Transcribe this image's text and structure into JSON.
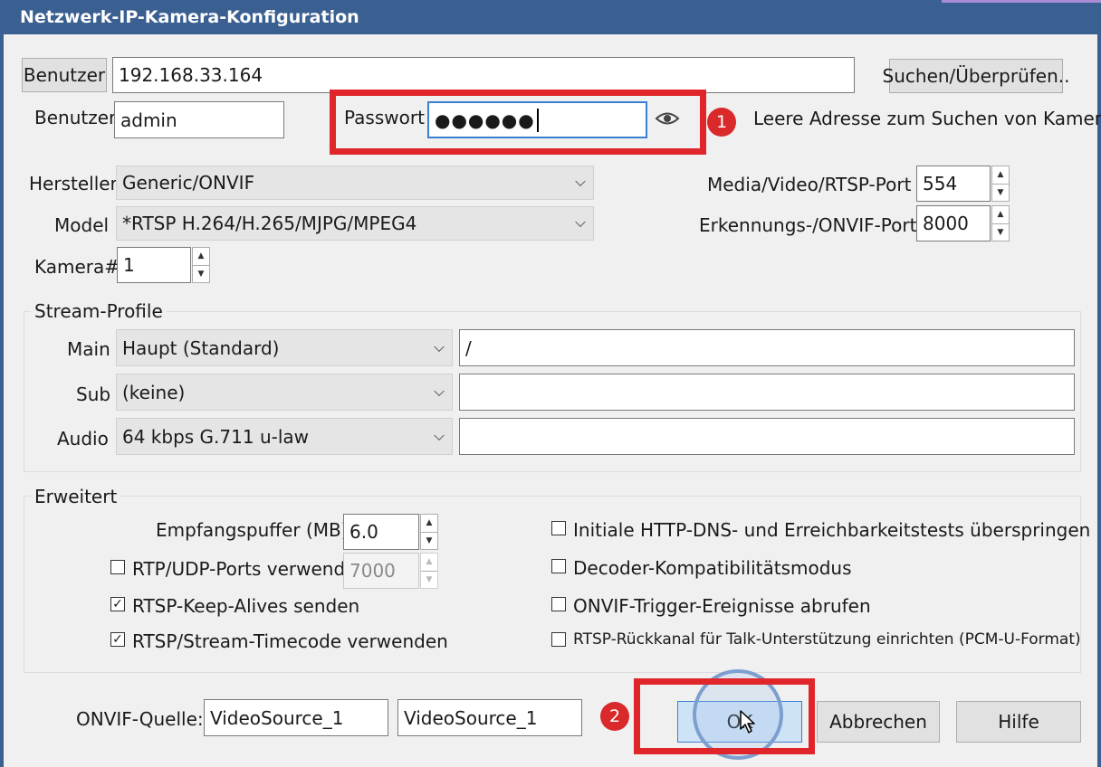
{
  "window": {
    "title": "Netzwerk-IP-Kamera-Konfiguration"
  },
  "address": {
    "button_label": "Benutzer",
    "value": "192.168.33.164",
    "search_button": "Suchen/Überprüfen.."
  },
  "login": {
    "user_label": "Benutzer",
    "user_value": "admin",
    "password_label": "Passwort",
    "password_value": "●●●●●●",
    "hint": "Leere Adresse zum Suchen von Kameras"
  },
  "device": {
    "manufacturer_label": "Hersteller",
    "manufacturer_value": "Generic/ONVIF",
    "model_label": "Model",
    "model_value": "*RTSP H.264/H.265/MJPG/MPEG4",
    "camera_label": "Kamera#",
    "camera_value": "1",
    "media_port_label": "Media/Video/RTSP-Port",
    "media_port_value": "554",
    "onvif_port_label": "Erkennungs-/ONVIF-Port",
    "onvif_port_value": "8000"
  },
  "streams": {
    "title": "Stream-Profile",
    "main_label": "Main",
    "main_value": "Haupt (Standard)",
    "main_path": "/",
    "sub_label": "Sub",
    "sub_value": "(keine)",
    "sub_path": "",
    "audio_label": "Audio",
    "audio_value": "64 kbps G.711 u-law",
    "audio_path": ""
  },
  "advanced": {
    "title": "Erweitert",
    "buffer_label": "Empfangspuffer (MB)",
    "buffer_value": "6.0",
    "rtp_label": "RTP/UDP-Ports verwenden",
    "rtp_checked": false,
    "rtp_value": "7000",
    "keepalive_label": "RTSP-Keep-Alives senden",
    "keepalive_checked": true,
    "timecode_label": "RTSP/Stream-Timecode verwenden",
    "timecode_checked": true,
    "skip_tests_label": "Initiale HTTP-DNS- und Erreichbarkeitstests überspringen",
    "skip_tests_checked": false,
    "decoder_label": "Decoder-Kompatibilitätsmodus",
    "decoder_checked": false,
    "onvif_trigger_label": "ONVIF-Trigger-Ereignisse abrufen",
    "onvif_trigger_checked": false,
    "backchannel_label": "RTSP-Rückkanal für Talk-Unterstützung einrichten (PCM-U-Format)",
    "backchannel_checked": false
  },
  "footer": {
    "onvif_source_label": "ONVIF-Quelle:",
    "onvif_source_1": "VideoSource_1",
    "onvif_source_2": "VideoSource_1",
    "ok_label": "OK",
    "cancel_label": "Abbrechen",
    "help_label": "Hilfe"
  },
  "annotations": {
    "badge_1": "1",
    "badge_2": "2",
    "highlight_color": "#e0262b"
  },
  "icons": {
    "reveal_password": "eye-icon",
    "check": "checkmark-icon",
    "spin_up": "up-arrow-icon",
    "spin_down": "down-arrow-icon",
    "combo": "chevron-down-icon"
  }
}
